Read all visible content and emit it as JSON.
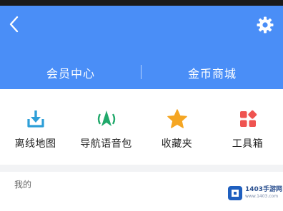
{
  "header": {
    "back_icon": "chevron-left-icon",
    "settings_icon": "gear-icon",
    "tabs": [
      {
        "label": "会员中心"
      },
      {
        "label": "金币商城"
      }
    ]
  },
  "tools": [
    {
      "label": "离线地图",
      "icon": "download-tray-icon",
      "color": "#2e9fd8"
    },
    {
      "label": "导航语音包",
      "icon": "navigation-voice-icon",
      "color": "#21a96b"
    },
    {
      "label": "收藏夹",
      "icon": "star-icon",
      "color": "#f5a623"
    },
    {
      "label": "工具箱",
      "icon": "toolbox-grid-icon",
      "color": "#ef5350"
    }
  ],
  "mine": {
    "label": "我的"
  },
  "watermark": {
    "text": "1403手游网",
    "sub": "www.1403.com"
  },
  "colors": {
    "header_bg": "#4a8ef7",
    "separator": "#f2f3f5"
  }
}
